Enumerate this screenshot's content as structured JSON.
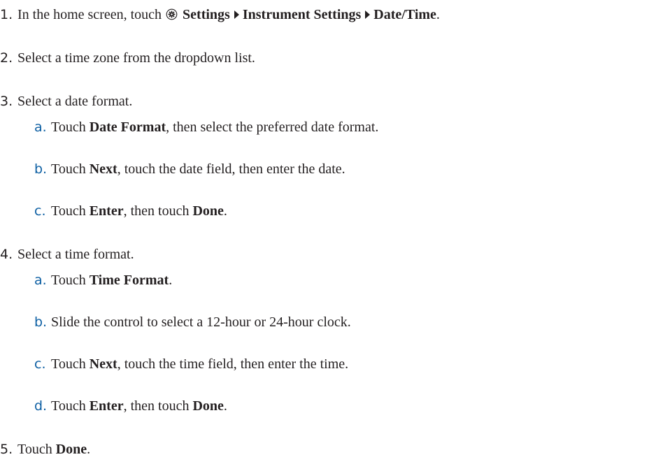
{
  "steps": [
    {
      "number": "1.",
      "pre": "In the home screen, touch",
      "icon": "settings-gear-icon",
      "path": [
        "Settings",
        "Instrument Settings",
        "Date/Time"
      ],
      "end": "."
    },
    {
      "number": "2.",
      "text": "Select a time zone from the dropdown list."
    },
    {
      "number": "3.",
      "text": "Select a date format.",
      "substeps": [
        {
          "letter": "a.",
          "parts": [
            "Touch ",
            "Date Format",
            ", then select the preferred date format."
          ]
        },
        {
          "letter": "b.",
          "parts": [
            "Touch ",
            "Next",
            ", touch the date field, then enter the date."
          ]
        },
        {
          "letter": "c.",
          "parts": [
            "Touch ",
            "Enter",
            ", then touch ",
            "Done",
            "."
          ]
        }
      ]
    },
    {
      "number": "4.",
      "text": "Select a time format.",
      "substeps": [
        {
          "letter": "a.",
          "parts": [
            "Touch ",
            "Time Format",
            "."
          ]
        },
        {
          "letter": "b.",
          "parts": [
            "Slide the control to select a 12-hour or 24-hour clock."
          ]
        },
        {
          "letter": "c.",
          "parts": [
            "Touch ",
            "Next",
            ", touch the time field, then enter the time."
          ]
        },
        {
          "letter": "d.",
          "parts": [
            "Touch ",
            "Enter",
            ", then touch ",
            "Done",
            "."
          ]
        }
      ]
    },
    {
      "number": "5.",
      "parts": [
        "Touch ",
        "Done",
        "."
      ]
    }
  ],
  "colors": {
    "text": "#231f20",
    "sub_letter": "#0d5fa3"
  }
}
